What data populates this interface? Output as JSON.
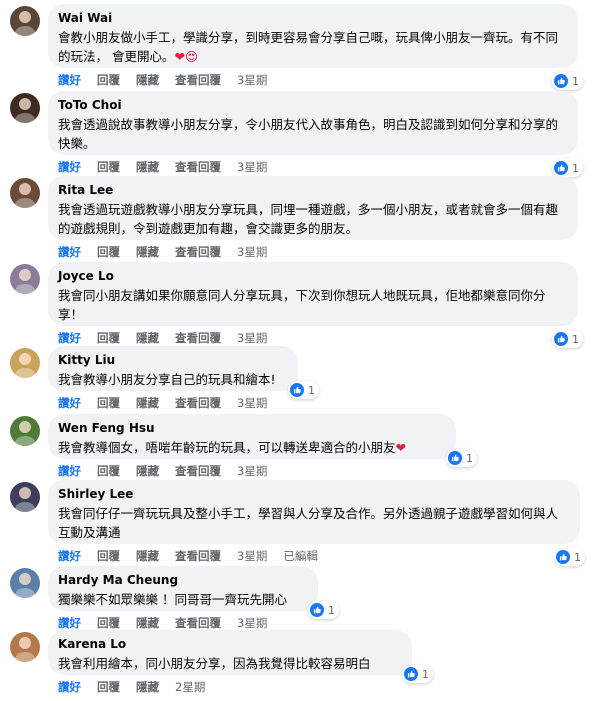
{
  "actions": {
    "like": "讚好",
    "reply": "回覆",
    "hide": "隱藏",
    "view_replies": "查看回覆",
    "edited": "已編輯"
  },
  "colors": {
    "like_blue": "#1877f2",
    "bubble": "#f0f2f5",
    "meta_gray": "#65676b"
  },
  "comments": [
    {
      "author": "Wai Wai",
      "text": "會教小朋友做小手工，學識分享，到時更容易會分享自己嘅，玩具俾小朋友一齊玩。有不同的玩法， 會更開心。",
      "emoji": "❤😍",
      "time": "3星期",
      "reactions": "1",
      "avatar_color": "#5a4636"
    },
    {
      "author": "ToTo Choi",
      "text": "我會透過說故事教導小朋友分享，令小朋友代入故事角色，明白及認識到如何分享和分享的快樂。",
      "time": "3星期",
      "reactions": "1",
      "avatar_color": "#3d2b22"
    },
    {
      "author": "Rita Lee",
      "text": "我會透過玩遊戲教導小朋友分享玩具，同埋一種遊戲，多一個小朋友，或者就會多一個有趣的遊戲規則，令到遊戲更加有趣，會交識更多的朋友。",
      "time": "3星期",
      "reactions": "",
      "avatar_color": "#6b4a3a"
    },
    {
      "author": "Joyce Lo",
      "text": "我會同小朋友講如果你願意同人分享玩具，下次到你想玩人地既玩具，佢地都樂意同你分享！",
      "time": "3星期",
      "reactions": "1",
      "avatar_color": "#8a7c9a"
    },
    {
      "author": "Kitty Liu",
      "text": "我會教導小朋友分享自己的玩具和繪本!",
      "time": "3星期",
      "reactions": "1",
      "avatar_color": "#c9a55b"
    },
    {
      "author": "Wen Feng Hsu",
      "text": "我會教導個女，唔啱年齡玩的玩具，可以轉送卑適合的小朋友",
      "emoji": "❤",
      "time": "3星期",
      "reactions": "1",
      "avatar_color": "#4f7a3a"
    },
    {
      "author": "Shirley Lee",
      "text": "我會同仔仔一齊玩玩具及整小手工，學習與人分享及合作。另外透過親子遊戲學習如何與人互動及溝通",
      "time": "3星期",
      "reactions": "1",
      "edited": true,
      "avatar_color": "#3b3f5a"
    },
    {
      "author": "Hardy Ma Cheung",
      "text": "獨樂樂不如眾樂樂 ！同哥哥一齊玩先開心",
      "time": "3星期",
      "reactions": "1",
      "avatar_color": "#5b7fa8"
    },
    {
      "author": "Karena Lo",
      "text": "我會利用繪本，同小朋友分享，因為我覺得比較容易明白",
      "time": "2星期",
      "reactions": "1",
      "avatar_color": "#b5784a"
    }
  ]
}
